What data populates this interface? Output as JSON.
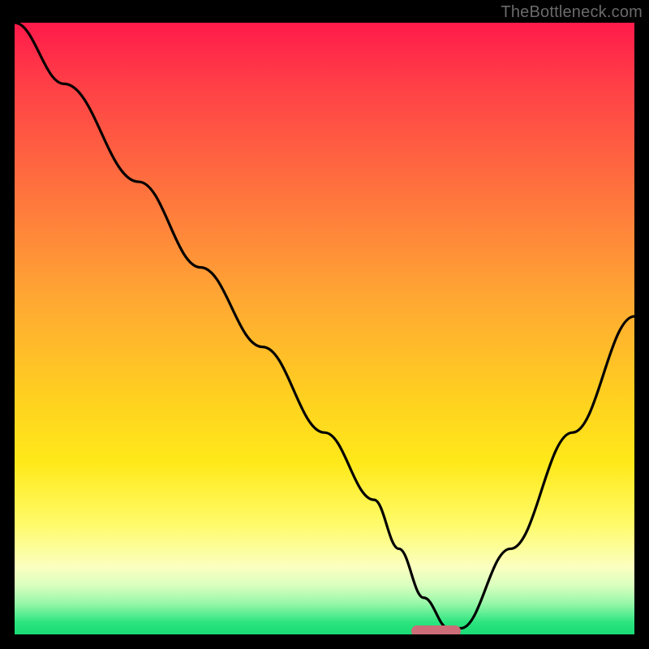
{
  "watermark": "TheBottleneck.com",
  "chart_data": {
    "type": "line",
    "title": "",
    "xlabel": "",
    "ylabel": "",
    "xlim": [
      0,
      100
    ],
    "ylim": [
      0,
      100
    ],
    "grid": false,
    "legend": false,
    "annotations": [],
    "series": [
      {
        "name": "bottleneck-curve",
        "x": [
          0,
          8,
          20,
          30,
          40,
          50,
          58,
          62,
          66,
          70,
          72,
          80,
          90,
          100
        ],
        "values": [
          100,
          90,
          74,
          60,
          47,
          33,
          22,
          14,
          6,
          1,
          1,
          14,
          33,
          52
        ]
      }
    ],
    "optimal_zone": {
      "x_start": 64,
      "x_end": 72,
      "y": 0.5
    },
    "gradient_stops": [
      {
        "pct": 0,
        "color": "#ff1a4b"
      },
      {
        "pct": 10,
        "color": "#ff3f47"
      },
      {
        "pct": 25,
        "color": "#ff6b3f"
      },
      {
        "pct": 45,
        "color": "#ffa733"
      },
      {
        "pct": 62,
        "color": "#ffd21f"
      },
      {
        "pct": 72,
        "color": "#ffe91a"
      },
      {
        "pct": 82,
        "color": "#fffb6a"
      },
      {
        "pct": 89,
        "color": "#fbffc0"
      },
      {
        "pct": 92,
        "color": "#d9ffbf"
      },
      {
        "pct": 95,
        "color": "#96f7a8"
      },
      {
        "pct": 98,
        "color": "#2de57f"
      },
      {
        "pct": 100,
        "color": "#18db74"
      }
    ]
  }
}
